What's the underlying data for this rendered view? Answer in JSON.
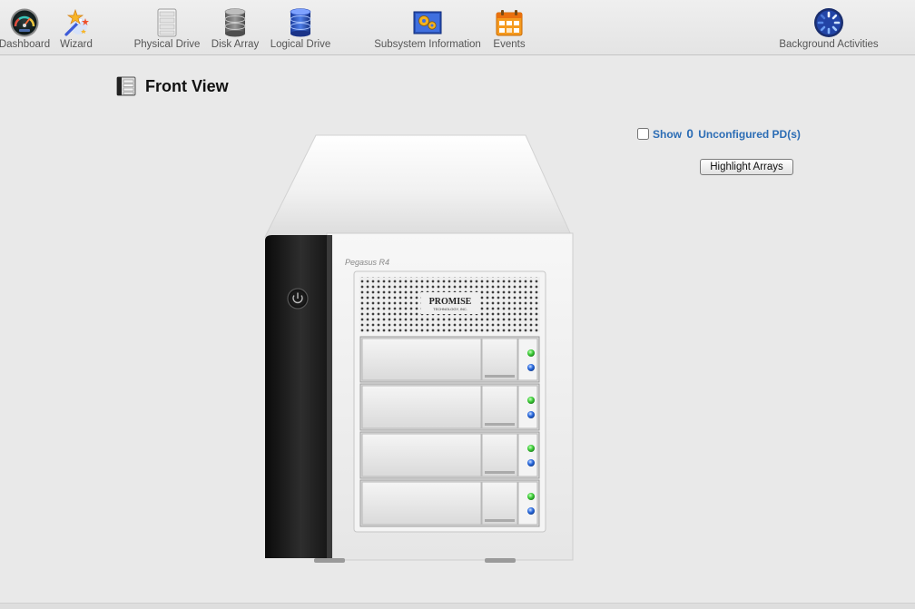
{
  "toolbar": {
    "items": [
      {
        "label": "Dashboard",
        "icon": "dashboard-gauge-icon"
      },
      {
        "label": "Wizard",
        "icon": "wizard-wand-icon"
      },
      {
        "label": "Physical Drive",
        "icon": "physical-drive-icon"
      },
      {
        "label": "Disk Array",
        "icon": "disk-array-icon"
      },
      {
        "label": "Logical Drive",
        "icon": "logical-drive-icon"
      },
      {
        "label": "Subsystem Information",
        "icon": "subsystem-info-icon"
      },
      {
        "label": "Events",
        "icon": "events-calendar-icon"
      },
      {
        "label": "Background Activities",
        "icon": "background-activities-spinner-icon"
      }
    ]
  },
  "page": {
    "title": "Front View",
    "title_icon": "enclosure-icon"
  },
  "controls": {
    "show_prefix": "Show",
    "show_count": "0",
    "show_suffix": "Unconfigured PD(s)",
    "show_checked": false,
    "highlight_label": "Highlight Arrays"
  },
  "device": {
    "brand": "PROMISE",
    "brand_sub": "TECHNOLOGY, INC.",
    "model_label": "Pegasus R4",
    "bays": [
      {
        "bay": 1,
        "led_top": "green",
        "led_bottom": "blue"
      },
      {
        "bay": 2,
        "led_top": "green",
        "led_bottom": "blue"
      },
      {
        "bay": 3,
        "led_top": "green",
        "led_bottom": "blue"
      },
      {
        "bay": 4,
        "led_top": "green",
        "led_bottom": "blue"
      }
    ]
  },
  "colors": {
    "link": "#2c6db5",
    "led_green": "#3fcf3a",
    "led_blue": "#2a6ae0"
  }
}
